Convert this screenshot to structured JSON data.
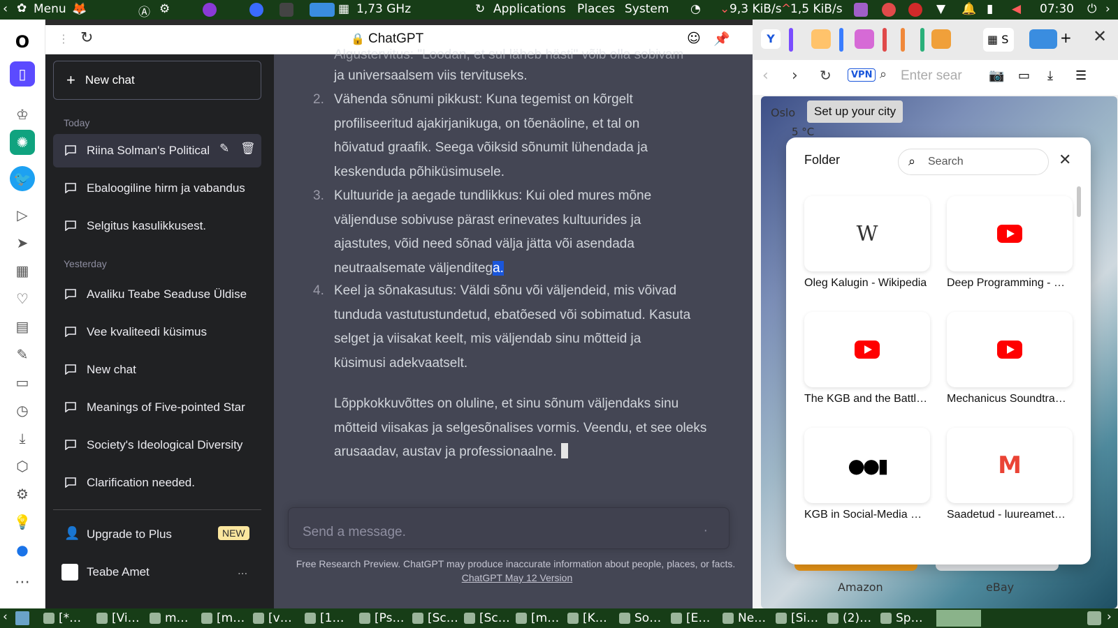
{
  "topbar": {
    "menu": "Menu",
    "cpu": "1,73 GHz",
    "applications": "Applications",
    "places": "Places",
    "system": "System",
    "net_down": "9,3 KiB/s",
    "net_up": "1,5 KiB/s",
    "time": "07:30"
  },
  "browser": {
    "title": "ChatGPT"
  },
  "sidebar": {
    "new_chat": "New chat",
    "today": "Today",
    "yesterday": "Yesterday",
    "today_items": [
      "Riina Solman's Political",
      "Ebaloogiline hirm ja vabandus",
      "Selgitus kasulikkusest."
    ],
    "yesterday_items": [
      "Avaliku Teabe Seaduse Üldise",
      "Vee kvaliteedi küsimus",
      "New chat",
      "Meanings of Five-pointed Star",
      "Society's Ideological Diversity",
      "Clarification needed."
    ],
    "upgrade": "Upgrade to Plus",
    "new_badge": "NEW",
    "account": "Teabe Amet",
    "more": "..."
  },
  "chat": {
    "item1_partial": "Algustervitus: \"Loodan, et sul läheb hästi\" võib olla sobivam",
    "item1_end": "ja universaalsem viis tervituseks.",
    "items": [
      {
        "num": "2.",
        "lines": [
          "Vähenda sõnumi pikkust: Kuna tegemist on kõrgelt",
          "profiliseeritud ajakirjanikuga, on tõenäoline, et tal on",
          "hõivatud graafik. Seega võiksid sõnumit lühendada ja",
          "keskenduda põhiküsimusele."
        ]
      },
      {
        "num": "3.",
        "lines": [
          "Kultuuride ja aegade tundlikkus: Kui oled mures mõne",
          "väljenduse sobivuse pärast erinevates kultuurides ja",
          "ajastutes, võid need sõnad välja jätta või asendada"
        ]
      },
      {
        "num": "4.",
        "lines": [
          "Keel ja sõnakasutus: Väldi sõnu või väljendeid, mis võivad",
          "tunduda vastutustundetud, ebatõesed või sobimatud. Kasuta",
          "selget ja viisakat keelt, mis väljendab sinu mõtteid ja",
          "küsimusi adekvaatselt."
        ]
      }
    ],
    "item3_last": "neutraalsemate väljenditeg",
    "item3_selected": "a.",
    "conclusion": [
      "Lõppkokkuvõttes on oluline, et sinu sõnum väljendaks sinu",
      "mõtteid viisakas ja selgesõnalises vormis. Veendu, et see oleks",
      "arusaadav, austav ja professionaalne."
    ],
    "composer_placeholder": "Send a message.",
    "footer_text": "Free Research Preview. ChatGPT may produce inaccurate information about people, places, or facts.",
    "footer_link": "ChatGPT May 12 Version"
  },
  "ext": {
    "search_placeholder": "Enter sear",
    "vpn": "VPN",
    "weather_city": "Oslo",
    "weather_temp": "5 °C",
    "setup_city": "Set up your city",
    "folder_title": "Folder",
    "folder_search": "Search",
    "tiles": [
      {
        "label": "Oleg Kalugin - Wikipedia",
        "icon": "wikipedia-icon"
      },
      {
        "label": "Deep Programming - …",
        "icon": "youtube-icon"
      },
      {
        "label": "The KGB and the Battl…",
        "icon": "youtube-icon"
      },
      {
        "label": "Mechanicus Soundtra…",
        "icon": "youtube-icon"
      },
      {
        "label": "KGB in Social-Media …",
        "icon": "medium-icon"
      },
      {
        "label": "Saadetud - luureamet…",
        "icon": "gmail-icon"
      }
    ],
    "bottom_tiles": [
      "Amazon",
      "eBay"
    ]
  },
  "taskbar": [
    "[*…",
    "[Vi…",
    "m…",
    "[m…",
    "[v…",
    "[1…",
    "[Ps…",
    "[Sc…",
    "[Sc…",
    "[m…",
    "[K…",
    "So…",
    "[E…",
    "Ne…",
    "[Si…",
    "(2)…",
    "Sp…"
  ],
  "colors": {
    "sidebar": "#202123",
    "chat_bg": "#444654",
    "selection": "#1a56db",
    "panel_green": "#173d17"
  }
}
